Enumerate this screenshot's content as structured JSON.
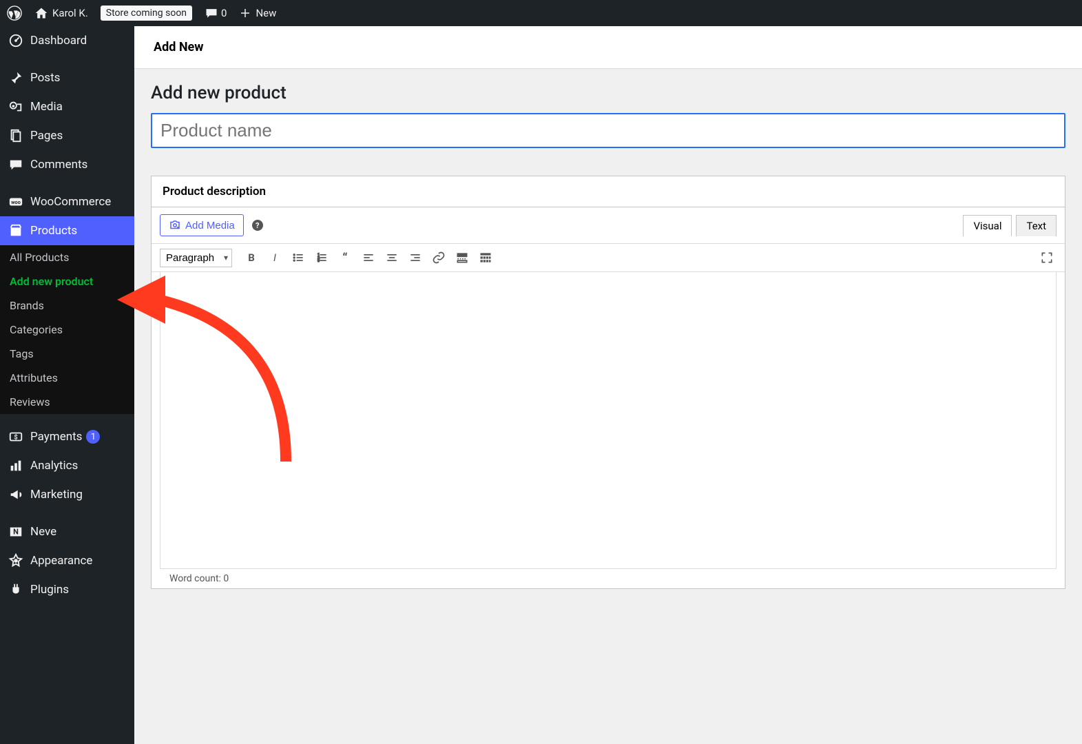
{
  "adminbar": {
    "site_name": "Karol K.",
    "store_badge": "Store coming soon",
    "comments_count": "0",
    "new_label": "New"
  },
  "sidebar": {
    "items": [
      {
        "icon": "dashboard",
        "label": "Dashboard"
      },
      {
        "icon": "pin",
        "label": "Posts"
      },
      {
        "icon": "media",
        "label": "Media"
      },
      {
        "icon": "pages",
        "label": "Pages"
      },
      {
        "icon": "comment",
        "label": "Comments"
      },
      {
        "icon": "woo",
        "label": "WooCommerce"
      },
      {
        "icon": "products",
        "label": "Products",
        "current": true
      },
      {
        "icon": "payments",
        "label": "Payments",
        "badge": "1"
      },
      {
        "icon": "analytics",
        "label": "Analytics"
      },
      {
        "icon": "marketing",
        "label": "Marketing"
      },
      {
        "icon": "neve",
        "label": "Neve"
      },
      {
        "icon": "appearance",
        "label": "Appearance"
      },
      {
        "icon": "plugins",
        "label": "Plugins"
      }
    ],
    "submenu": [
      {
        "label": "All Products"
      },
      {
        "label": "Add new product",
        "active": true
      },
      {
        "label": "Brands"
      },
      {
        "label": "Categories"
      },
      {
        "label": "Tags"
      },
      {
        "label": "Attributes"
      },
      {
        "label": "Reviews"
      }
    ]
  },
  "page": {
    "header_title": "Add New",
    "heading": "Add new product",
    "title_placeholder": "Product name"
  },
  "editor": {
    "box_title": "Product description",
    "add_media_label": "Add Media",
    "tab_visual": "Visual",
    "tab_text": "Text",
    "format_option": "Paragraph",
    "word_count_label": "Word count: 0"
  }
}
